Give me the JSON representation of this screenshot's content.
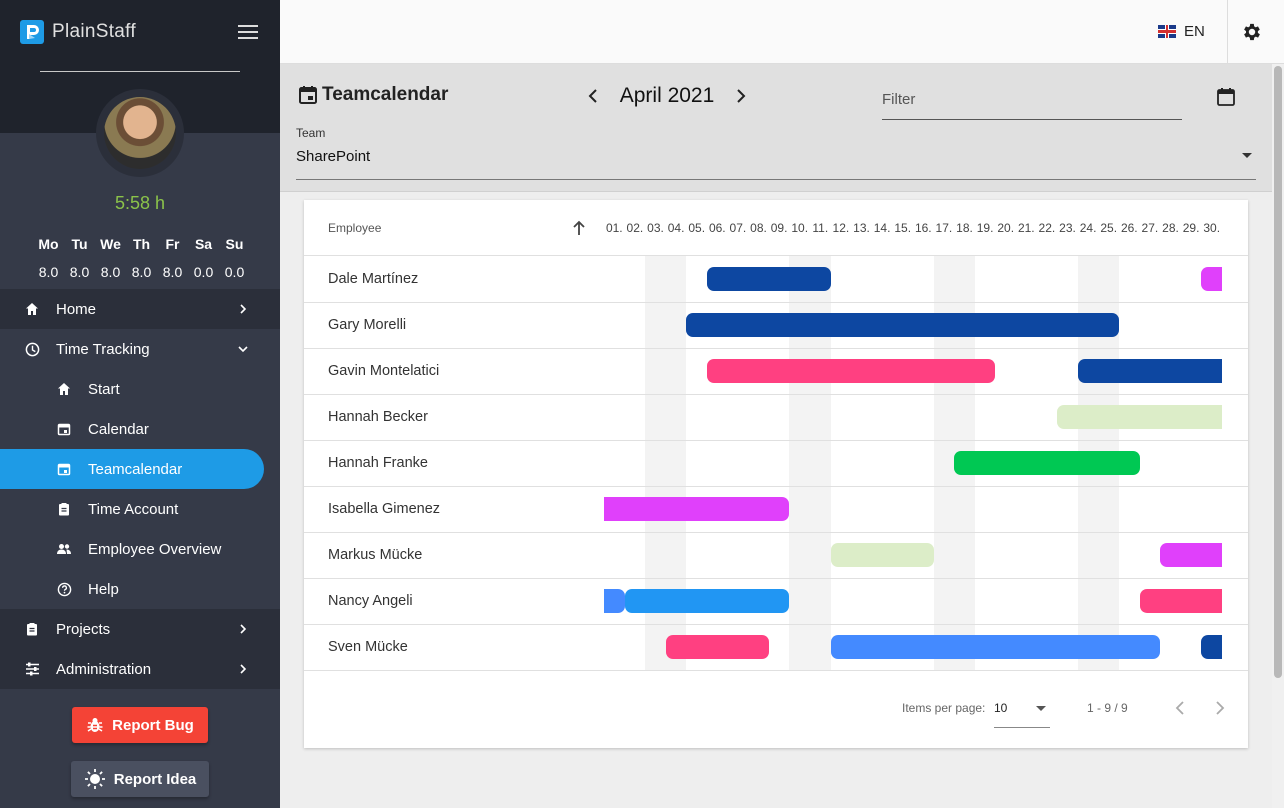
{
  "app": {
    "name": "PlainStaff"
  },
  "profile": {
    "hours_today": "5:58 h",
    "week": [
      {
        "day": "Mo",
        "hours": "8.0"
      },
      {
        "day": "Tu",
        "hours": "8.0"
      },
      {
        "day": "We",
        "hours": "8.0"
      },
      {
        "day": "Th",
        "hours": "8.0"
      },
      {
        "day": "Fr",
        "hours": "8.0"
      },
      {
        "day": "Sa",
        "hours": "0.0"
      },
      {
        "day": "Su",
        "hours": "0.0"
      }
    ]
  },
  "nav": {
    "home": "Home",
    "time_tracking": "Time Tracking",
    "start": "Start",
    "calendar": "Calendar",
    "teamcalendar": "Teamcalendar",
    "time_account": "Time Account",
    "employee_overview": "Employee Overview",
    "help": "Help",
    "projects": "Projects",
    "administration": "Administration"
  },
  "buttons": {
    "report_bug": "Report Bug",
    "report_idea": "Report Idea"
  },
  "topbar": {
    "language": "EN"
  },
  "header": {
    "title": "Teamcalendar",
    "month": "April 2021",
    "filter_placeholder": "Filter",
    "team_label": "Team",
    "team_value": "SharePoint"
  },
  "table": {
    "employee_header": "Employee",
    "days": [
      "01.",
      "02.",
      "03.",
      "04.",
      "05.",
      "06.",
      "07.",
      "08.",
      "09.",
      "10.",
      "11.",
      "12.",
      "13.",
      "14.",
      "15.",
      "16.",
      "17.",
      "18.",
      "19.",
      "20.",
      "21.",
      "22.",
      "23.",
      "24.",
      "25.",
      "26.",
      "27.",
      "28.",
      "29.",
      "30."
    ],
    "weekend_days": [
      3,
      4,
      10,
      11,
      17,
      18,
      24,
      25
    ],
    "rows": [
      {
        "name": "Dale Martínez",
        "absences": [
          {
            "start": 6,
            "end": 11,
            "color": "#0d47a1"
          },
          {
            "start": 30,
            "end": 30,
            "color": "#e040fb"
          }
        ]
      },
      {
        "name": "Gary Morelli",
        "absences": [
          {
            "start": 5,
            "end": 25,
            "color": "#0d47a1"
          }
        ]
      },
      {
        "name": "Gavin Montelatici",
        "absences": [
          {
            "start": 6,
            "end": 19,
            "color": "#ff4081"
          },
          {
            "start": 24,
            "end": 30,
            "color": "#0d47a1"
          }
        ]
      },
      {
        "name": "Hannah Becker",
        "absences": [
          {
            "start": 23,
            "end": 30,
            "color": "#dcedc8"
          }
        ]
      },
      {
        "name": "Hannah Franke",
        "absences": [
          {
            "start": 18,
            "end": 26,
            "color": "#00c853"
          }
        ]
      },
      {
        "name": "Isabella Gimenez",
        "absences": [
          {
            "start": 1,
            "end": 9,
            "color": "#e040fb"
          }
        ]
      },
      {
        "name": "Markus Mücke",
        "absences": [
          {
            "start": 12,
            "end": 16,
            "color": "#dcedc8"
          },
          {
            "start": 28,
            "end": 30,
            "color": "#e040fb"
          }
        ]
      },
      {
        "name": "Nancy Angeli",
        "absences": [
          {
            "start": 1,
            "end": 1,
            "color": "#448aff"
          },
          {
            "start": 2,
            "end": 9,
            "color": "#2196f3"
          },
          {
            "start": 27,
            "end": 30,
            "color": "#ff4081"
          }
        ]
      },
      {
        "name": "Sven Mücke",
        "absences": [
          {
            "start": 4,
            "end": 8,
            "color": "#ff4081"
          },
          {
            "start": 12,
            "end": 27,
            "color": "#448aff"
          },
          {
            "start": 30,
            "end": 30,
            "color": "#0d47a1"
          }
        ]
      }
    ]
  },
  "paginator": {
    "items_per_page_label": "Items per page:",
    "page_size": "10",
    "range": "1 - 9 / 9"
  }
}
